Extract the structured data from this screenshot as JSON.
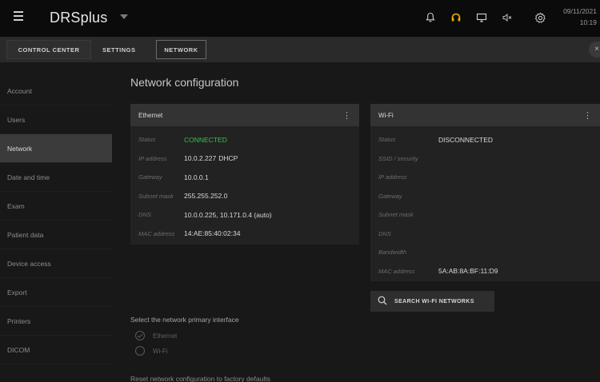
{
  "app": {
    "title": "DRSplus"
  },
  "topbar": {
    "date": "09/11/2021",
    "time": "10:19",
    "icons": [
      "bell-icon",
      "headset-icon",
      "monitor-icon",
      "speaker-muted-icon",
      "gear-icon"
    ],
    "headset_color": "#f0b400"
  },
  "breadcrumb": {
    "items": [
      "CONTROL CENTER",
      "SETTINGS",
      "NETWORK"
    ],
    "close_label": "×"
  },
  "sidebar": {
    "items": [
      {
        "label": "Account"
      },
      {
        "label": "Users"
      },
      {
        "label": "Network"
      },
      {
        "label": "Date and time"
      },
      {
        "label": "Exam"
      },
      {
        "label": "Patient data"
      },
      {
        "label": "Device access"
      },
      {
        "label": "Export"
      },
      {
        "label": "Printers"
      },
      {
        "label": "DICOM"
      }
    ],
    "active": "Network"
  },
  "main": {
    "title": "Network configuration",
    "ethernet": {
      "title": "Ethernet",
      "rows": [
        {
          "label": "Status",
          "value": "CONNECTED"
        },
        {
          "label": "IP address",
          "value": "10.0.2.227",
          "extra": "DHCP"
        },
        {
          "label": "Gateway",
          "value": "10.0.0.1"
        },
        {
          "label": "Subnet mask",
          "value": "255.255.252.0"
        },
        {
          "label": "DNS",
          "value": "10.0.0.225, 10.171.0.4 (auto)"
        },
        {
          "label": "MAC address",
          "value": "14:AE:85:40:02:34"
        }
      ]
    },
    "wifi": {
      "title": "Wi-Fi",
      "rows": [
        {
          "label": "Status",
          "value": "DISCONNECTED"
        },
        {
          "label": "SSID / security",
          "value": ""
        },
        {
          "label": "IP address",
          "value": ""
        },
        {
          "label": "Gateway",
          "value": ""
        },
        {
          "label": "Subnet mask",
          "value": ""
        },
        {
          "label": "DNS",
          "value": ""
        },
        {
          "label": "Bandwidth",
          "value": ""
        },
        {
          "label": "MAC address",
          "value": "5A:AB:8A:BF:11:D9"
        }
      ],
      "search_label": "SEARCH WI-FI NETWORKS"
    },
    "primary_interface": {
      "label": "Select the network primary interface",
      "options": [
        "Ethernet",
        "Wi-Fi"
      ],
      "selected": "Ethernet"
    },
    "reset_label": "Reset network configuration to factory defaults"
  },
  "colors": {
    "connected": "#33c24a",
    "background": "#181818",
    "topbar": "#0b0b0b",
    "card_header": "#333333"
  }
}
